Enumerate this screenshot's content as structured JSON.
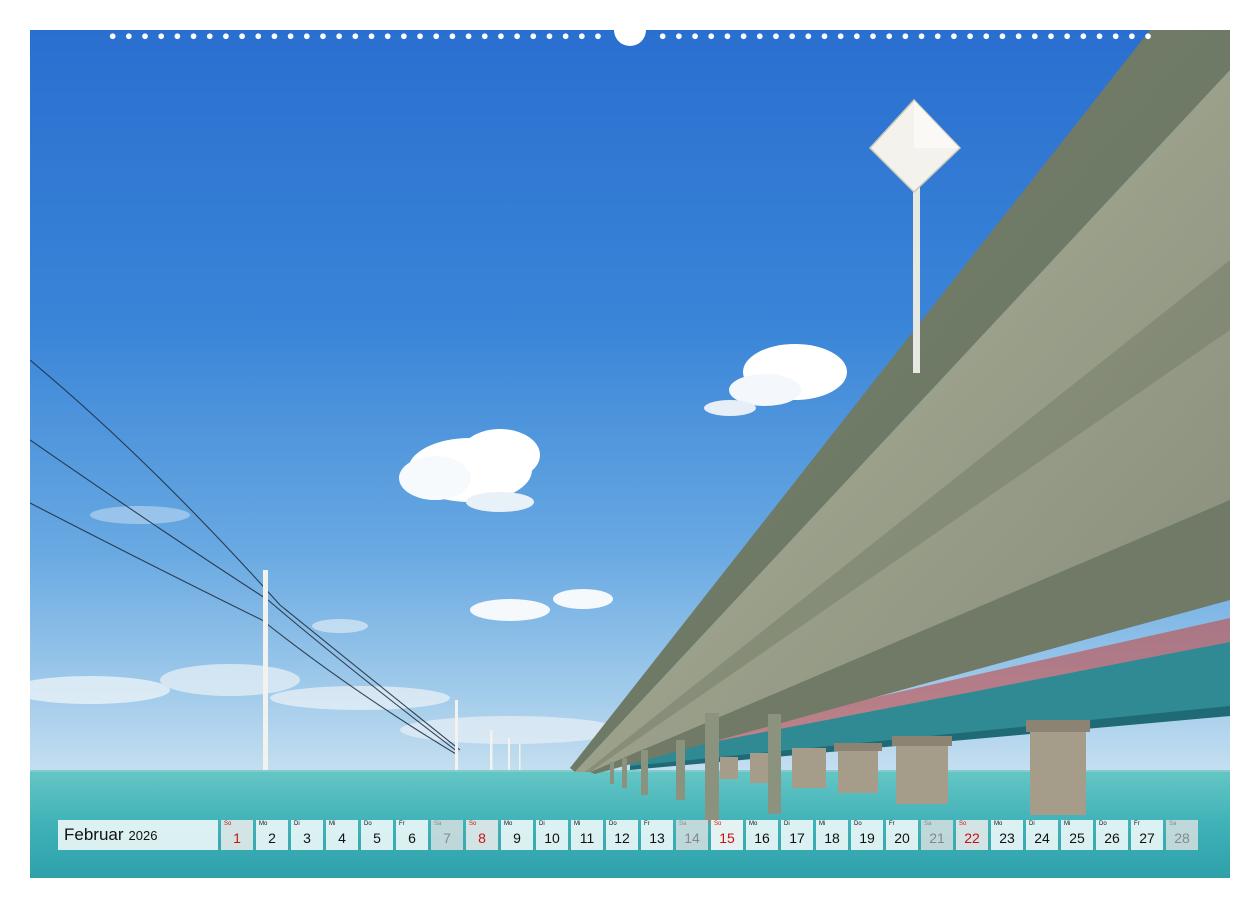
{
  "calendar": {
    "month": "Februar",
    "year": "2026",
    "days": [
      {
        "wd": "So",
        "d": "1",
        "kind": "sunday"
      },
      {
        "wd": "Mo",
        "d": "2",
        "kind": "normal"
      },
      {
        "wd": "Di",
        "d": "3",
        "kind": "normal"
      },
      {
        "wd": "Mi",
        "d": "4",
        "kind": "normal"
      },
      {
        "wd": "Do",
        "d": "5",
        "kind": "normal"
      },
      {
        "wd": "Fr",
        "d": "6",
        "kind": "normal"
      },
      {
        "wd": "Sa",
        "d": "7",
        "kind": "weekend"
      },
      {
        "wd": "So",
        "d": "8",
        "kind": "sunday"
      },
      {
        "wd": "Mo",
        "d": "9",
        "kind": "normal"
      },
      {
        "wd": "Di",
        "d": "10",
        "kind": "normal"
      },
      {
        "wd": "Mi",
        "d": "11",
        "kind": "normal"
      },
      {
        "wd": "Do",
        "d": "12",
        "kind": "normal"
      },
      {
        "wd": "Fr",
        "d": "13",
        "kind": "normal"
      },
      {
        "wd": "Sa",
        "d": "14",
        "kind": "weekend"
      },
      {
        "wd": "So",
        "d": "15",
        "kind": "holiday"
      },
      {
        "wd": "Mo",
        "d": "16",
        "kind": "normal"
      },
      {
        "wd": "Di",
        "d": "17",
        "kind": "normal"
      },
      {
        "wd": "Mi",
        "d": "18",
        "kind": "normal"
      },
      {
        "wd": "Do",
        "d": "19",
        "kind": "normal"
      },
      {
        "wd": "Fr",
        "d": "20",
        "kind": "normal"
      },
      {
        "wd": "Sa",
        "d": "21",
        "kind": "weekend"
      },
      {
        "wd": "So",
        "d": "22",
        "kind": "sunday"
      },
      {
        "wd": "Mo",
        "d": "23",
        "kind": "normal"
      },
      {
        "wd": "Di",
        "d": "24",
        "kind": "normal"
      },
      {
        "wd": "Mi",
        "d": "25",
        "kind": "normal"
      },
      {
        "wd": "Do",
        "d": "26",
        "kind": "normal"
      },
      {
        "wd": "Fr",
        "d": "27",
        "kind": "normal"
      },
      {
        "wd": "Sa",
        "d": "28",
        "kind": "weekend"
      }
    ]
  },
  "colors": {
    "sky_top": "#2a6fcf",
    "sea": "#45bcc0",
    "bridge_concrete": "#8e9682",
    "old_bridge": "#2f8a94",
    "sunday_red": "#cc1111"
  }
}
